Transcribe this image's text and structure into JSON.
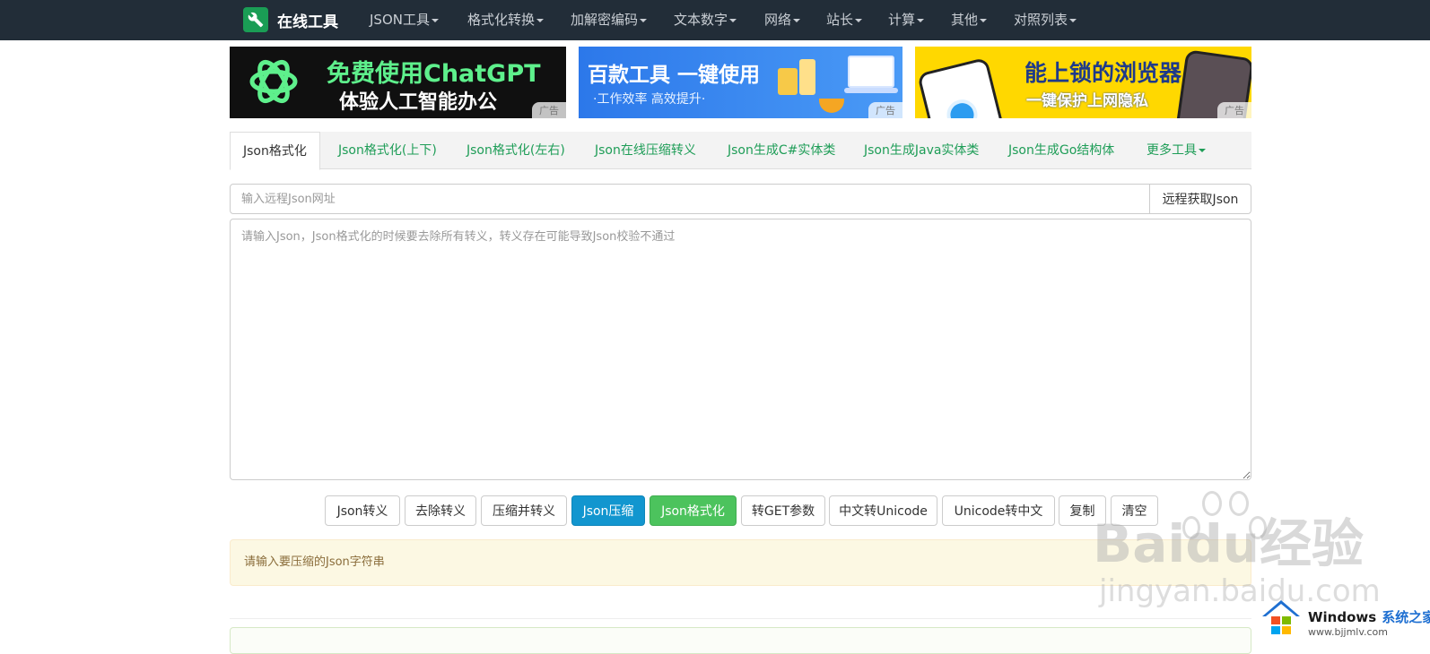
{
  "navbar": {
    "brand": "在线工具",
    "items": [
      "JSON工具",
      "格式化转换",
      "加解密编码",
      "文本数字",
      "网络",
      "站长",
      "计算",
      "其他",
      "对照列表"
    ]
  },
  "ads": [
    {
      "line1": "免费使用ChatGPT",
      "line2": "体验人工智能办公",
      "tag": "广告"
    },
    {
      "line1": "百款工具 一键使用",
      "line2": "·工作效率 高效提升·",
      "tag": "广告"
    },
    {
      "line1": "能上锁的浏览器",
      "line2": "一键保护上网隐私",
      "tag": "广告"
    }
  ],
  "tabs": [
    "Json格式化",
    "Json格式化(上下)",
    "Json格式化(左右)",
    "Json在线压缩转义",
    "Json生成C#实体类",
    "Json生成Java实体类",
    "Json生成Go结构体",
    "更多工具"
  ],
  "url_input": {
    "placeholder": "输入远程Json网址",
    "button": "远程获取Json"
  },
  "editor": {
    "placeholder": "请输入Json，Json格式化的时候要去除所有转义，转义存在可能导致Json校验不通过"
  },
  "buttons": [
    "Json转义",
    "去除转义",
    "压缩并转义",
    "Json压缩",
    "Json格式化",
    "转GET参数",
    "中文转Unicode",
    "Unicode转中文",
    "复制",
    "清空"
  ],
  "alert": {
    "message": "请输入要压缩的Json字符串"
  },
  "watermark": {
    "baidu": "Baidu经验",
    "jingyan": "jingyan.baidu.com",
    "windows": "Windows",
    "windows_cn": "系统之家",
    "windows_url": "www.bjjmlv.com"
  },
  "colors": {
    "navbar": "#222d38",
    "accent_green": "#1e9d57",
    "btn_info": "#1296cf",
    "btn_success": "#4cc35d",
    "alert_bg": "#fcf8e3"
  }
}
